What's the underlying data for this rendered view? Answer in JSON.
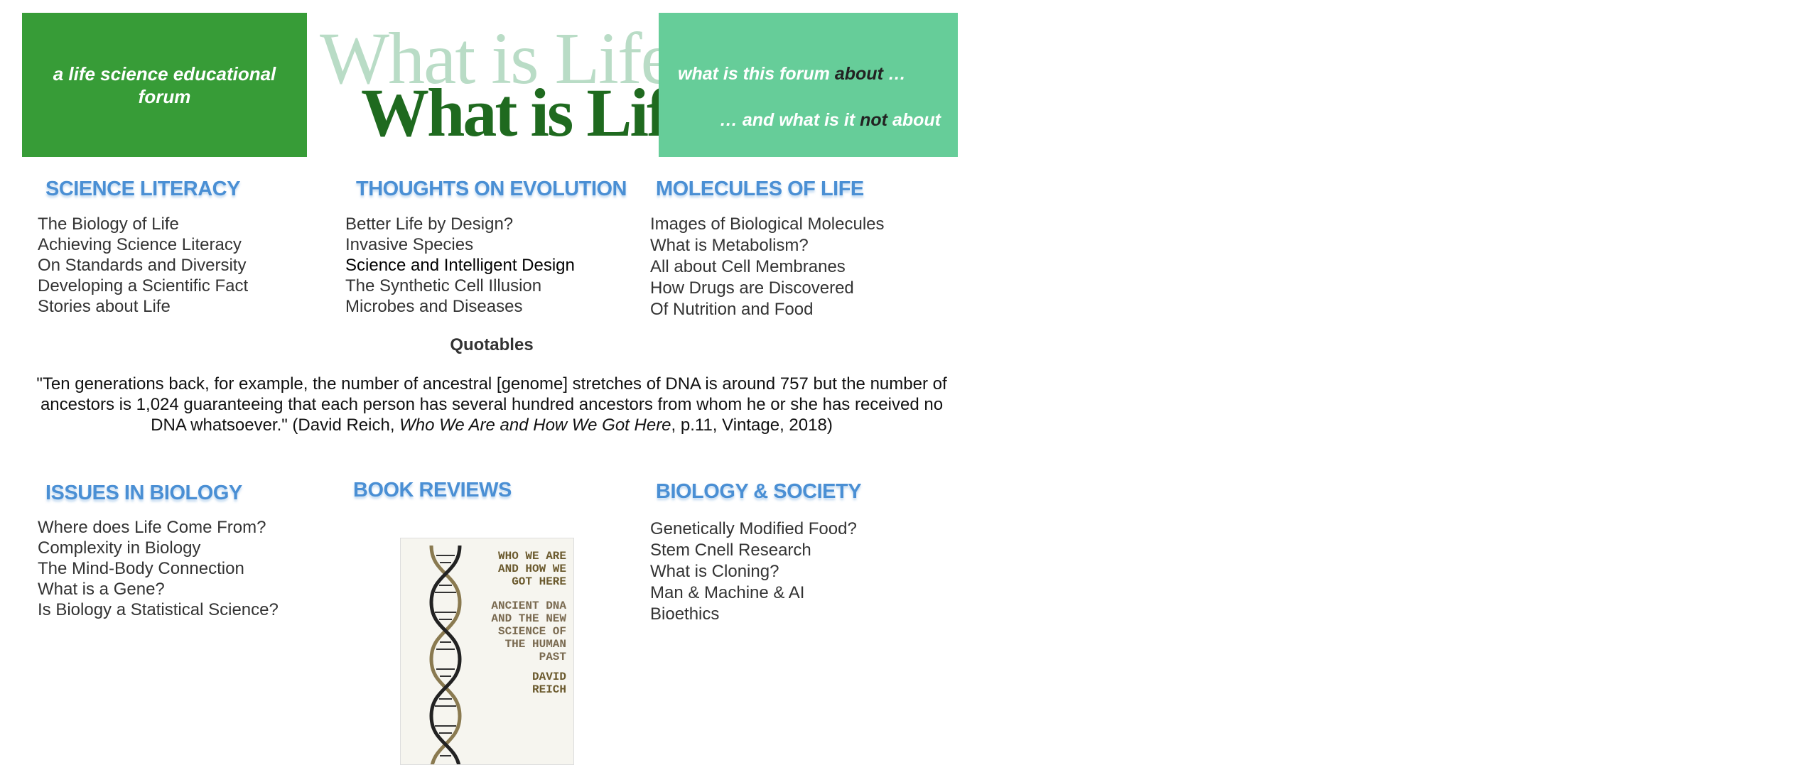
{
  "banner": {
    "tagline": "a life science educational forum",
    "logo_text": "What is Life",
    "about_line": {
      "prefix": "what is this forum ",
      "highlight": "about",
      "suffix": " …"
    },
    "not_about_line": {
      "prefix": "… and what is it ",
      "highlight": "not",
      "suffix": " about"
    },
    "colors": {
      "left_tile": "#379c37",
      "right_tile": "#66cd99",
      "heading_blue": "#4a8fd4"
    }
  },
  "sections": {
    "science_literacy": {
      "title": "SCIENCE LITERACY",
      "items": [
        "The Biology of Life",
        "Achieving Science Literacy",
        "On Standards and Diversity",
        "Developing a Scientific Fact",
        "Stories about Life"
      ]
    },
    "evolution": {
      "title": "THOUGHTS ON EVOLUTION",
      "items": [
        "Better Life by Design?",
        "Invasive Species",
        "Science and Intelligent Design",
        "The Synthetic Cell Illusion",
        "Microbes and Diseases"
      ]
    },
    "molecules": {
      "title": "MOLECULES OF LIFE",
      "items": [
        "Images of Biological Molecules",
        "What is Metabolism?",
        "All about Cell Membranes",
        "How Drugs are Discovered",
        "Of Nutrition and Food"
      ]
    },
    "issues": {
      "title": "ISSUES IN BIOLOGY",
      "items": [
        "Where does Life Come From?",
        "Complexity in Biology",
        "The Mind-Body Connection",
        "What is a Gene?",
        "Is Biology a Statistical Science?"
      ]
    },
    "book_reviews": {
      "title": "BOOK REVIEWS"
    },
    "society": {
      "title": "BIOLOGY & SOCIETY",
      "items": [
        "Genetically Modified Food?",
        "Stem Cnell Research",
        "What is Cloning?",
        "Man & Machine & AI",
        "Bioethics"
      ]
    }
  },
  "quotables": {
    "title": "Quotables",
    "text_before": "\"Ten generations back, for example, the number of ancestral [genome] stretches of DNA is around 757 but the number of ancestors is 1,024 guaranteeing that each person has several hundred ancestors from whom he or she has received no DNA whatsoever.\" (David Reich, ",
    "book_title": "Who We Are and How We Got Here",
    "text_after": ", p.11, Vintage, 2018)"
  },
  "book_cover": {
    "title": "WHO WE ARE AND HOW WE GOT HERE",
    "subtitle": "ANCIENT DNA AND THE NEW SCIENCE OF THE HUMAN PAST",
    "author": "DAVID REICH",
    "icon": "dna-double-helix"
  }
}
